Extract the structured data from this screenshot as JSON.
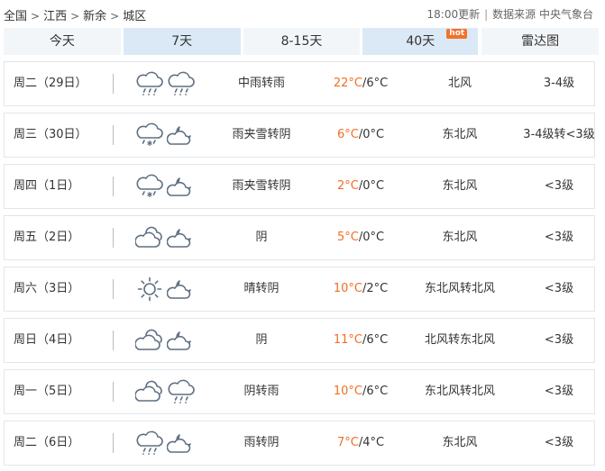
{
  "breadcrumb": {
    "items": [
      "全国",
      "江西",
      "新余",
      "城区"
    ],
    "separator": ">"
  },
  "meta": {
    "update": "18:00更新",
    "source": "数据来源 中央气象台"
  },
  "tabs": [
    {
      "label": "今天"
    },
    {
      "label": "7天"
    },
    {
      "label": "8-15天"
    },
    {
      "label": "40天",
      "badge": "hot"
    },
    {
      "label": "雷达图"
    }
  ],
  "colors": {
    "accent": "#f26e22",
    "tab_active": "#dbe9f6",
    "tab_light": "#f3f6f9",
    "badge": "#f2712a"
  },
  "days": [
    {
      "date": "周二（29日）",
      "icon_day": "rain-icon",
      "icon_night": "rain-icon",
      "condition": "中雨转雨",
      "high": "22°C",
      "low": "/6°C",
      "wind": "北风",
      "level": "3-4级"
    },
    {
      "date": "周三（30日）",
      "icon_day": "sleet-icon",
      "icon_night": "cloudy-night-icon",
      "condition": "雨夹雪转阴",
      "high": "6°C",
      "low": "/0°C",
      "wind": "东北风",
      "level": "3-4级转<3级"
    },
    {
      "date": "周四（1日）",
      "icon_day": "sleet-icon",
      "icon_night": "cloudy-night-icon",
      "condition": "雨夹雪转阴",
      "high": "2°C",
      "low": "/0°C",
      "wind": "东北风",
      "level": "<3级"
    },
    {
      "date": "周五（2日）",
      "icon_day": "overcast-icon",
      "icon_night": "cloudy-night-icon",
      "condition": "阴",
      "high": "5°C",
      "low": "/0°C",
      "wind": "东北风",
      "level": "<3级"
    },
    {
      "date": "周六（3日）",
      "icon_day": "sunny-icon",
      "icon_night": "cloudy-night-icon",
      "condition": "晴转阴",
      "high": "10°C",
      "low": "/2°C",
      "wind": "东北风转北风",
      "level": "<3级"
    },
    {
      "date": "周日（4日）",
      "icon_day": "overcast-icon",
      "icon_night": "cloudy-night-icon",
      "condition": "阴",
      "high": "11°C",
      "low": "/6°C",
      "wind": "北风转东北风",
      "level": "<3级"
    },
    {
      "date": "周一（5日）",
      "icon_day": "overcast-icon",
      "icon_night": "rain-icon",
      "condition": "阴转雨",
      "high": "10°C",
      "low": "/6°C",
      "wind": "东北风转北风",
      "level": "<3级"
    },
    {
      "date": "周二（6日）",
      "icon_day": "rain-icon",
      "icon_night": "cloudy-night-icon",
      "condition": "雨转阴",
      "high": "7°C",
      "low": "/4°C",
      "wind": "东北风",
      "level": "<3级"
    }
  ]
}
